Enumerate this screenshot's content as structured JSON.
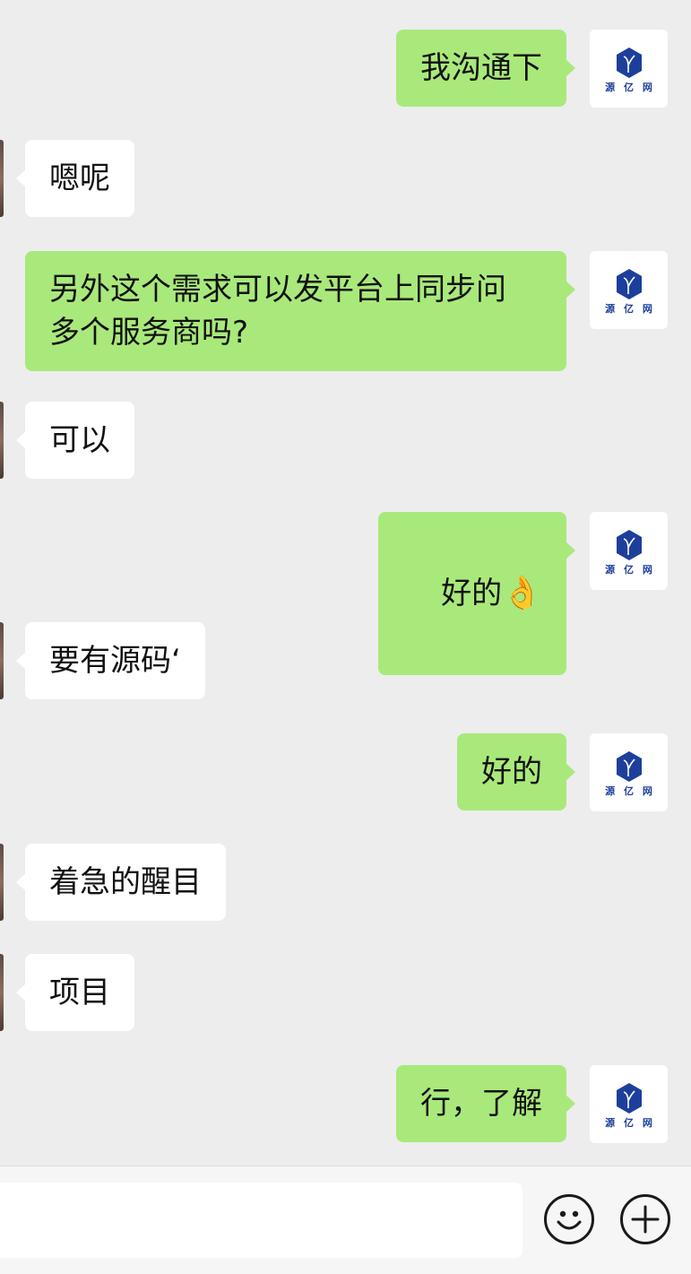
{
  "chat": {
    "messages": [
      {
        "side": "out",
        "text": "我沟通下"
      },
      {
        "side": "in",
        "text": "嗯呢"
      },
      {
        "side": "out",
        "text": "另外这个需求可以发平台上同步问\n多个服务商吗?"
      },
      {
        "side": "in",
        "text": "可以"
      },
      {
        "side": "out",
        "text": "好的",
        "emoji": "👌"
      },
      {
        "side": "in",
        "text": "要有源码‘"
      },
      {
        "side": "out",
        "text": "好的"
      },
      {
        "side": "in",
        "text": "着急的醒目"
      },
      {
        "side": "in",
        "text": "项目"
      },
      {
        "side": "out",
        "text": "行，了解"
      }
    ]
  },
  "self_avatar": {
    "brand": "源 亿 网",
    "icon": "hexagon-y-logo",
    "color": "#1d3f9c"
  },
  "input_bar": {
    "placeholder": "",
    "emoji_icon": "smiley-face-icon",
    "plus_icon": "plus-circle-icon"
  },
  "colors": {
    "outgoing_bubble": "#a9e97b",
    "incoming_bubble": "#ffffff",
    "background": "#ededed"
  }
}
